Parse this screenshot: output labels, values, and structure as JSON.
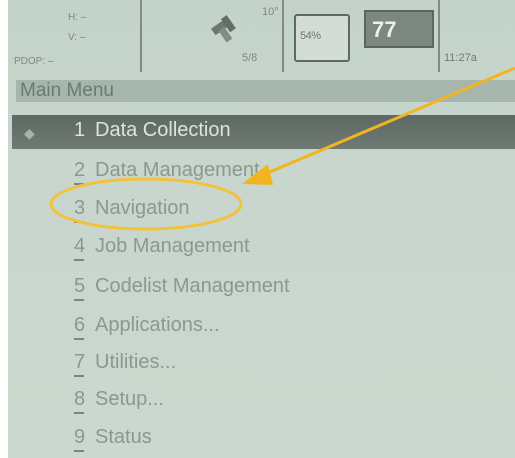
{
  "status_bar": {
    "position": {
      "he": "H: –",
      "ve": "V: –",
      "pdop": "PDOP: –"
    },
    "satellites": {
      "count": "5/8",
      "angle": "10°"
    },
    "battery": {
      "label": "54%"
    },
    "memory": {
      "value": "77"
    },
    "clock": {
      "time": "11:27a"
    }
  },
  "title": "Main Menu",
  "menu_items": [
    {
      "number": "1",
      "label": "Data Collection",
      "selected": true
    },
    {
      "number": "2",
      "label": "Data Management"
    },
    {
      "number": "3",
      "label": "Navigation"
    },
    {
      "number": "4",
      "label": "Job Management"
    },
    {
      "number": "5",
      "label": "Codelist Management"
    },
    {
      "number": "6",
      "label": "Applications..."
    },
    {
      "number": "7",
      "label": "Utilities..."
    },
    {
      "number": "8",
      "label": "Setup..."
    },
    {
      "number": "9",
      "label": "Status"
    }
  ],
  "annotation": {
    "arrow_color": "#f3b51f",
    "circle_color": "#f3c23a"
  }
}
